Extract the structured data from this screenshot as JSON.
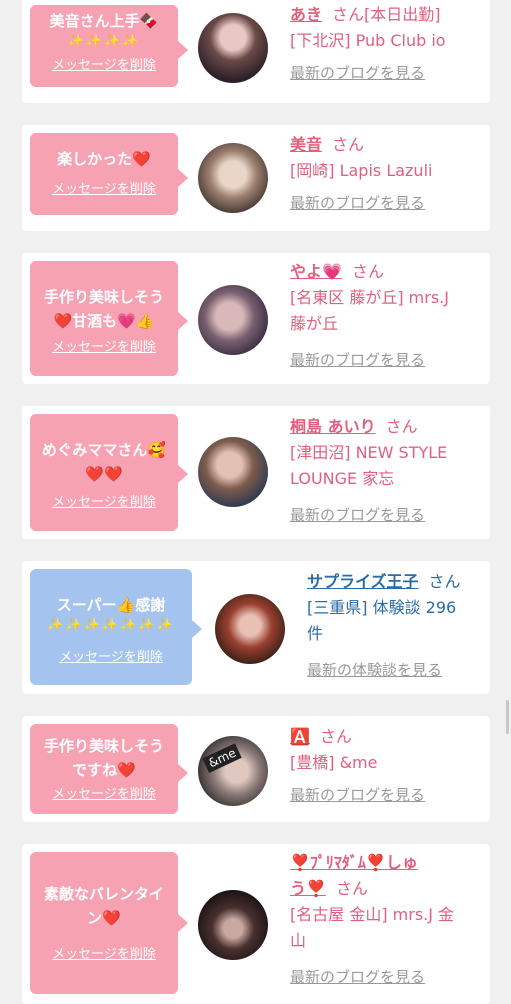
{
  "cards": [
    {
      "message": "美音さん上手🍫",
      "message2": "✨✨✨✨",
      "delete_label": "メッセージを削除",
      "name": "あき",
      "honorific": "さん[本日出勤]",
      "shop": "[下北沢] Pub Club io",
      "blog_link": "最新のブログを見る"
    },
    {
      "message": "楽しかった❤️",
      "delete_label": "メッセージを削除",
      "name": "美音",
      "honorific": "さん",
      "shop": "[岡崎] Lapis Lazuli",
      "blog_link": "最新のブログを見る"
    },
    {
      "message": "手作り美味しそう",
      "message2": "❤️甘酒も💗👍",
      "delete_label": "メッセージを削除",
      "name": "やよ💗",
      "honorific": "さん",
      "shop": "[名東区 藤が丘] mrs.J",
      "shop2": "藤が丘",
      "blog_link": "最新のブログを見る"
    },
    {
      "message": "めぐみママさん🥰",
      "message2": "❤️❤️",
      "delete_label": "メッセージを削除",
      "name": "桐島 あいり",
      "honorific": "さん",
      "shop": "[津田沼] NEW STYLE",
      "shop2": "LOUNGE 家忘",
      "blog_link": "最新のブログを見る"
    },
    {
      "message": "スーパー👍感謝",
      "message2": "✨✨✨✨✨✨✨",
      "delete_label": "メッセージを削除",
      "name": "サプライズ王子",
      "honorific": "さん",
      "shop": "[三重県] 体験談 296",
      "shop2": "件",
      "blog_link": "最新の体験談を見る"
    },
    {
      "message": "手作り美味しそう",
      "message2": "ですね❤️",
      "delete_label": "メッセージを削除",
      "name": "🅰️",
      "honorific": "さん",
      "shop": "[豊橋] &me",
      "blog_link": "最新のブログを見る",
      "avatar_text": "&me"
    },
    {
      "message": "素敵なバレンタイ",
      "message2": "ン❤️",
      "delete_label": "メッセージを削除",
      "name": "❣️ﾌﾟﾘﾏﾀﾞﾑ❣️しゅ",
      "name2": "う❣️",
      "honorific": "さん",
      "shop": "[名古屋 金山] mrs.J 金",
      "shop2": "山",
      "blog_link": "最新のブログを見る"
    }
  ],
  "colors": {
    "pink_bubble": "#f7a2b3",
    "blue_bubble": "#a4c3ef",
    "name_pink": "#e0607e",
    "name_blue": "#2b6ca6"
  }
}
